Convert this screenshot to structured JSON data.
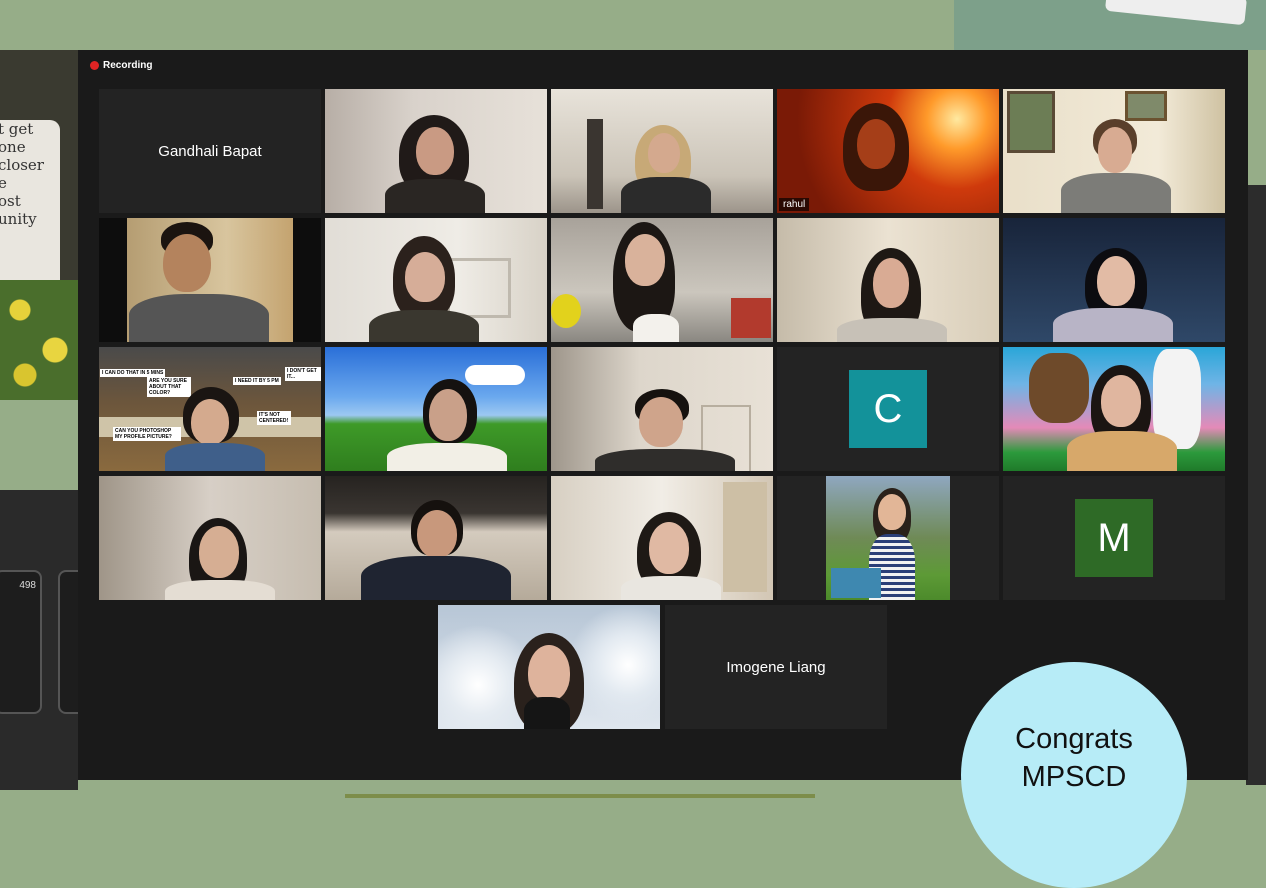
{
  "window": {
    "recording_label": "Recording"
  },
  "participants": {
    "gandhali": "Gandhali Bapat",
    "rahul": "rahul",
    "c_initial": "C",
    "m_initial": "M",
    "imogene": "Imogene Liang"
  },
  "meme": {
    "b1": "I CAN DO THAT IN 5 MINS",
    "b2": "ARE YOU SURE ABOUT THAT COLOR?",
    "b3": "I NEED IT BY 5 PM",
    "b4": "I DON'T GET IT...",
    "b5": "IT'S NOT CENTERED!",
    "b6": "CAN YOU PHOTOSHOP MY PROFILE PICTURE?"
  },
  "background": {
    "phone_text": [
      "t get",
      "one",
      "closer",
      "e",
      "ost",
      "unity"
    ],
    "mini_phone_value": "498"
  },
  "overlay": {
    "line1": "Congrats",
    "line2": "MPSCD"
  },
  "colors": {
    "active_border": "#c9df5e",
    "c_avatar": "#13929a",
    "m_avatar": "#2e6a26",
    "recording": "#e02424"
  }
}
